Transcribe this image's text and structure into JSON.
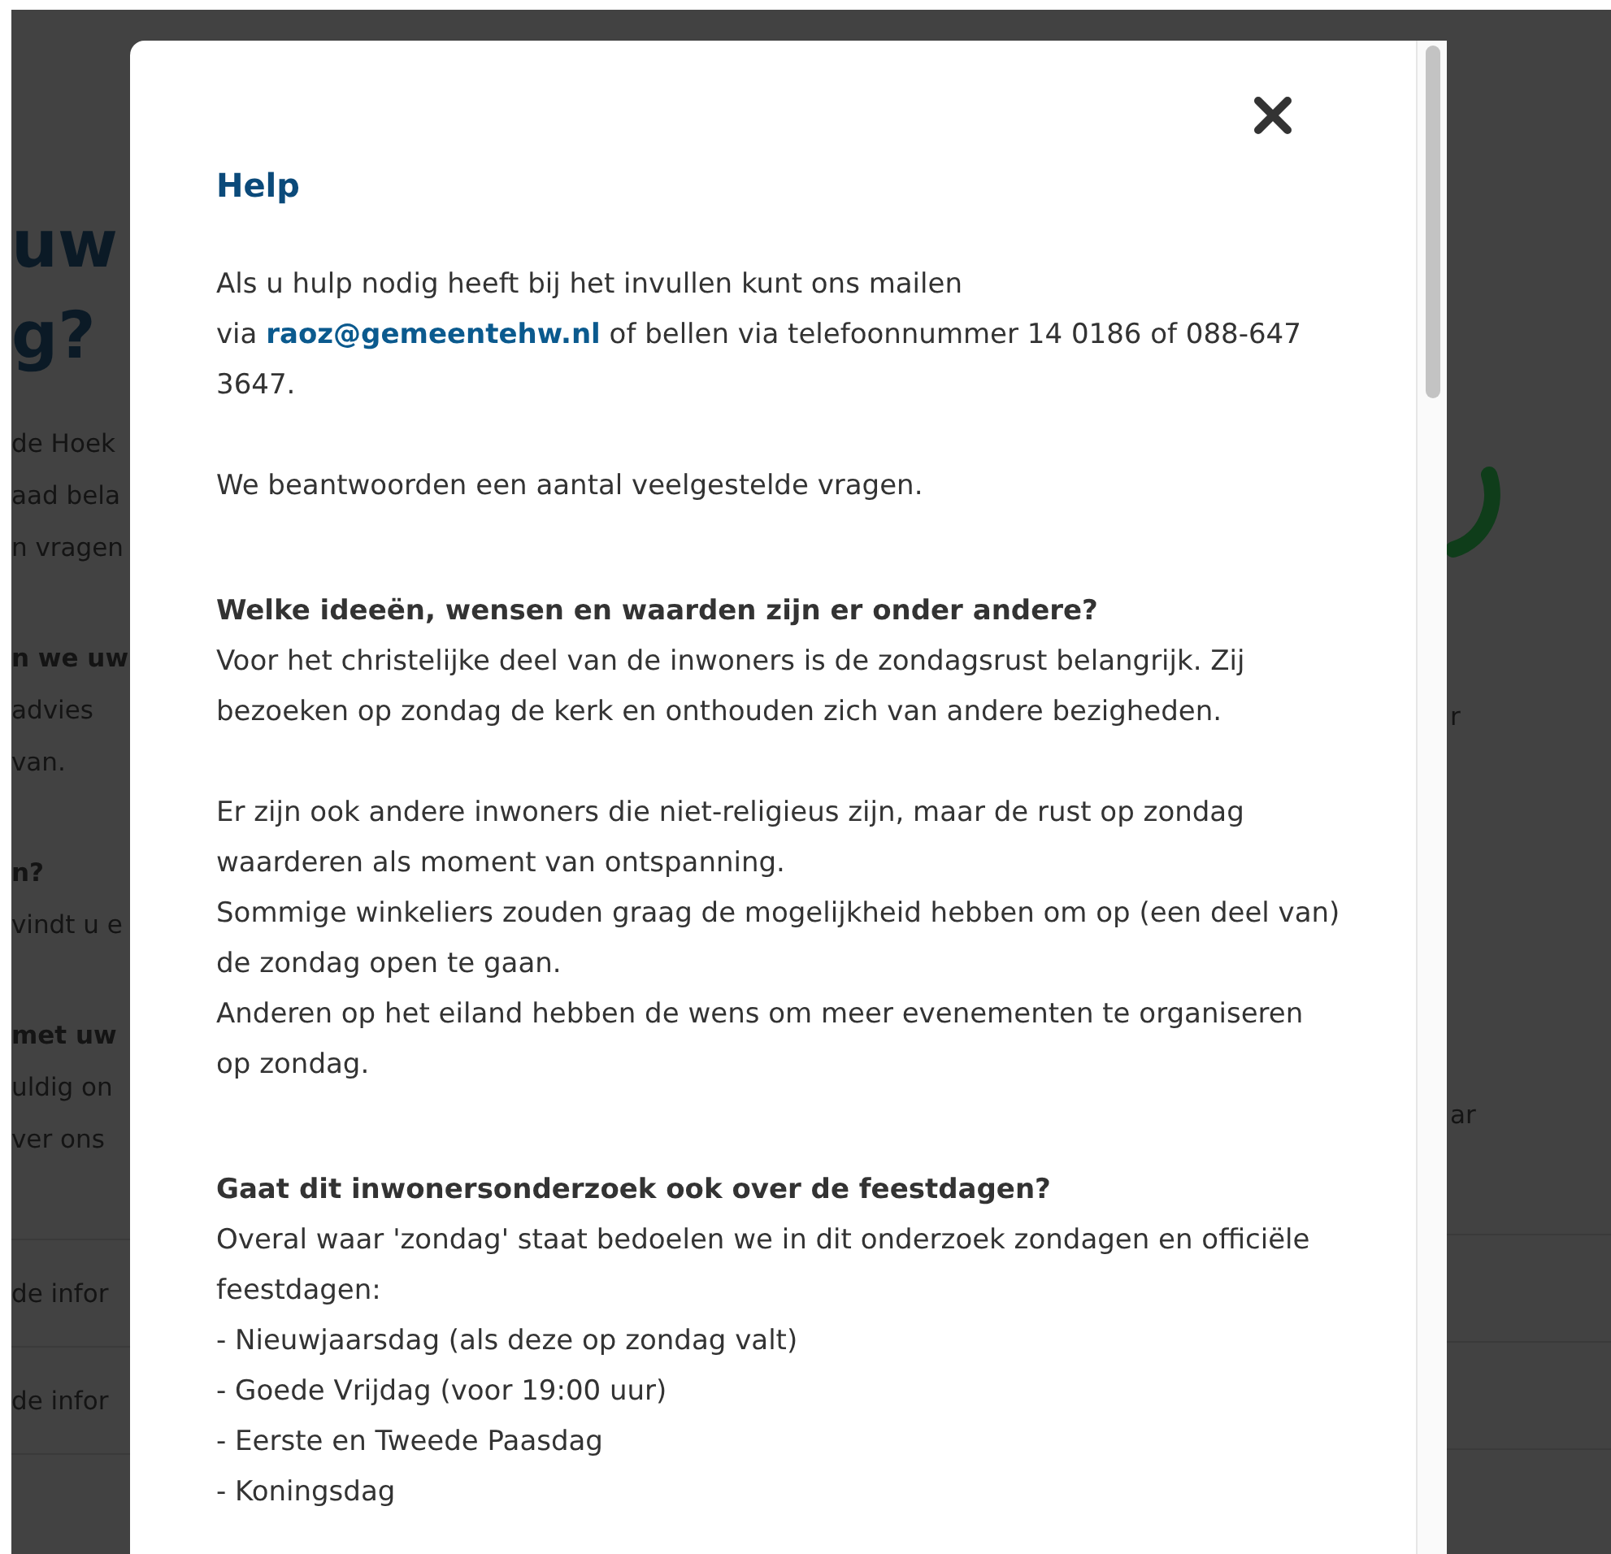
{
  "background": {
    "left": {
      "heading_lines": [
        "uw",
        "g?"
      ],
      "groups": [
        {
          "lines": [
            {
              "text": "de Hoek",
              "bold": false
            },
            {
              "text": "aad bela",
              "bold": false
            },
            {
              "text": "n vragen",
              "bold": false
            }
          ]
        },
        {
          "lines": [
            {
              "text": "n we uw",
              "bold": true
            },
            {
              "text": "advies",
              "bold": false
            },
            {
              "text": "van.",
              "bold": false
            }
          ]
        },
        {
          "lines": [
            {
              "text": "n?",
              "bold": true
            },
            {
              "text": "vindt u e",
              "bold": false
            }
          ]
        },
        {
          "lines": [
            {
              "text": "met uw",
              "bold": true
            },
            {
              "text": "uldig on",
              "bold": false
            },
            {
              "text": "ver ons",
              "bold": false
            }
          ]
        }
      ],
      "rows": [
        "de infor",
        "de infor"
      ]
    },
    "right": {
      "texts": [
        "r",
        "ar"
      ]
    }
  },
  "modal": {
    "title": "Help",
    "intro": {
      "first_line": "Als u hulp nodig heeft bij het invullen kunt ons mailen",
      "before": "via ",
      "link": "raoz@gemeentehw.nl",
      "after": " of bellen via telefoonnummer 14 0186 of 088-647 3647."
    },
    "sections": [
      [
        {
          "kind": "text",
          "text": "We beantwoorden een aantal veelgestelde vragen."
        }
      ],
      [
        {
          "kind": "heading",
          "text": "Welke ideeën, wensen en waarden zijn er onder andere?"
        },
        {
          "kind": "text",
          "text": "Voor het christelijke deel van de inwoners is de zondagsrust belangrijk. Zij bezoeken op zondag de kerk en onthouden zich van andere bezigheden."
        }
      ],
      [
        {
          "kind": "text",
          "text": "Er zijn ook andere inwoners die niet-religieus zijn, maar de rust op zondag waarderen als moment van ontspanning."
        },
        {
          "kind": "text",
          "text": "Sommige winkeliers zouden graag de mogelijkheid hebben om op (een deel van) de zondag open te gaan."
        },
        {
          "kind": "text",
          "text": "Anderen op het eiland hebben de wens om meer evenementen te organiseren op zondag."
        }
      ],
      [
        {
          "kind": "heading",
          "text": "Gaat dit inwonersonderzoek ook over de feestdagen?"
        },
        {
          "kind": "text",
          "text": "Overal waar 'zondag' staat bedoelen we in dit onderzoek zondagen en officiële feestdagen:"
        },
        {
          "kind": "text",
          "text": "- Nieuwjaarsdag (als deze op zondag valt)"
        },
        {
          "kind": "text",
          "text": "- Goede Vrijdag (voor 19:00 uur)"
        },
        {
          "kind": "text",
          "text": "- Eerste en Tweede Paasdag"
        },
        {
          "kind": "text",
          "text": "- Koningsdag"
        }
      ]
    ]
  }
}
